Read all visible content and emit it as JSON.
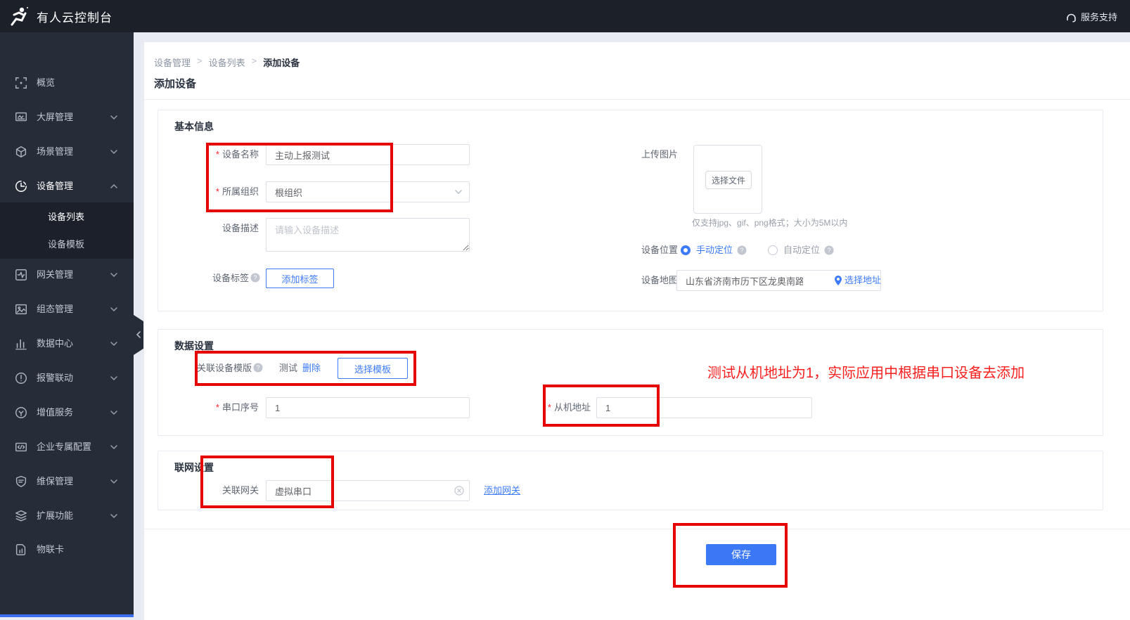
{
  "topbar": {
    "title": "有人云控制台",
    "support_label": "服务支持"
  },
  "sidebar": {
    "items": [
      {
        "label": "概览",
        "icon": "overview-icon"
      },
      {
        "label": "大屏管理",
        "icon": "big-screen-icon",
        "chevron": "down"
      },
      {
        "label": "场景管理",
        "icon": "scene-icon",
        "chevron": "down"
      },
      {
        "label": "设备管理",
        "icon": "device-icon",
        "chevron": "up",
        "active": true
      },
      {
        "label": "网关管理",
        "icon": "gateway-icon",
        "chevron": "down"
      },
      {
        "label": "组态管理",
        "icon": "scada-icon",
        "chevron": "down"
      },
      {
        "label": "数据中心",
        "icon": "data-center-icon",
        "chevron": "down"
      },
      {
        "label": "报警联动",
        "icon": "alarm-icon",
        "chevron": "down"
      },
      {
        "label": "增值服务",
        "icon": "value-service-icon",
        "chevron": "down"
      },
      {
        "label": "企业专属配置",
        "icon": "enterprise-config-icon",
        "chevron": "down"
      },
      {
        "label": "维保管理",
        "icon": "maintenance-icon",
        "chevron": "down"
      },
      {
        "label": "扩展功能",
        "icon": "extension-icon",
        "chevron": "down"
      },
      {
        "label": "物联卡",
        "icon": "iot-card-icon"
      }
    ],
    "submenu": [
      {
        "label": "设备列表",
        "active": true
      },
      {
        "label": "设备模板",
        "active": false
      }
    ]
  },
  "breadcrumb": {
    "items": [
      "设备管理",
      "设备列表",
      "添加设备"
    ],
    "separator": ">"
  },
  "page": {
    "title": "添加设备",
    "required_marker": "*"
  },
  "basic_info": {
    "section_title": "基本信息",
    "device_name_label": "设备名称",
    "device_name_value": "主动上报测试",
    "org_label": "所属组织",
    "org_value": "根组织",
    "desc_label": "设备描述",
    "desc_placeholder": "请输入设备描述",
    "tag_label": "设备标签",
    "add_tag_button": "添加标签",
    "upload_label": "上传图片",
    "choose_file_button": "选择文件",
    "upload_hint": "仅支持jpg、gif、png格式；大小为5M以内",
    "location_label": "设备位置",
    "manual_location": "手动定位",
    "auto_location": "自动定位",
    "map_label": "设备地图",
    "map_value": "山东省济南市历下区龙奥南路",
    "choose_address_link": "选择地址"
  },
  "data_settings": {
    "section_title": "数据设置",
    "template_label": "关联设备模版",
    "template_value": "测试",
    "delete_link": "删除",
    "select_template_button": "选择模板",
    "serial_label": "串口序号",
    "serial_value": "1",
    "slave_label": "从机地址",
    "slave_value": "1",
    "annotation": "测试从机地址为1，实际应用中根据串口设备去添加"
  },
  "network_settings": {
    "section_title": "联网设置",
    "gateway_label": "关联网关",
    "gateway_value": "虚拟串口",
    "add_gateway_link": "添加网关"
  },
  "footer": {
    "save_button": "保存"
  },
  "colors": {
    "accent": "#3d7bfd",
    "highlight_red": "#e60000",
    "sidebar_bg": "#262c38",
    "topbar_bg": "#1b2029"
  }
}
